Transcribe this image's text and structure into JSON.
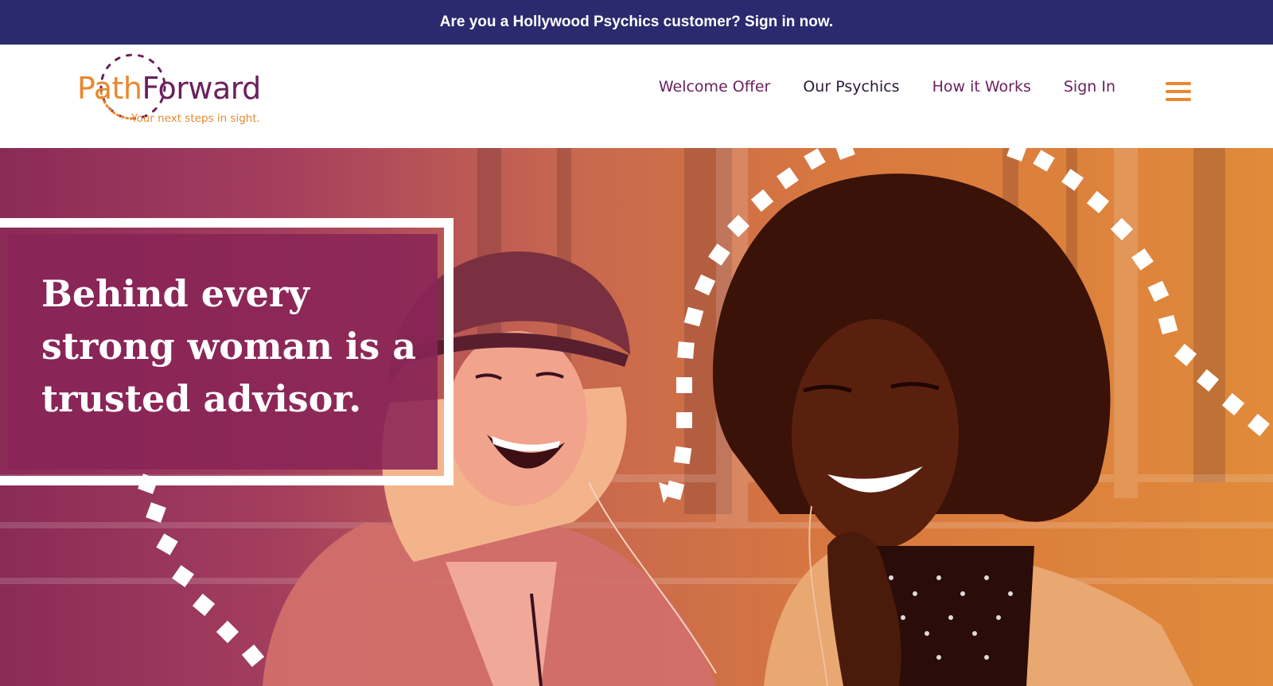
{
  "banner": {
    "text": "Are you a Hollywood Psychics customer? Sign in now."
  },
  "logo": {
    "path": "Path",
    "forward": "Forward",
    "tagline": "Your next steps in sight."
  },
  "nav": {
    "welcome_offer": "Welcome Offer",
    "our_psychics": "Our Psychics",
    "how_it_works": "How it Works",
    "sign_in": "Sign In",
    "menu_icon": "hamburger-menu-icon"
  },
  "hero": {
    "headline": "Behind every strong woman is a trusted advisor."
  },
  "colors": {
    "banner_bg": "#2b2a6e",
    "brand_orange": "#e8892f",
    "brand_plum": "#6b1f5c",
    "hero_plum": "#892456",
    "hero_orange": "#e08a3a"
  }
}
